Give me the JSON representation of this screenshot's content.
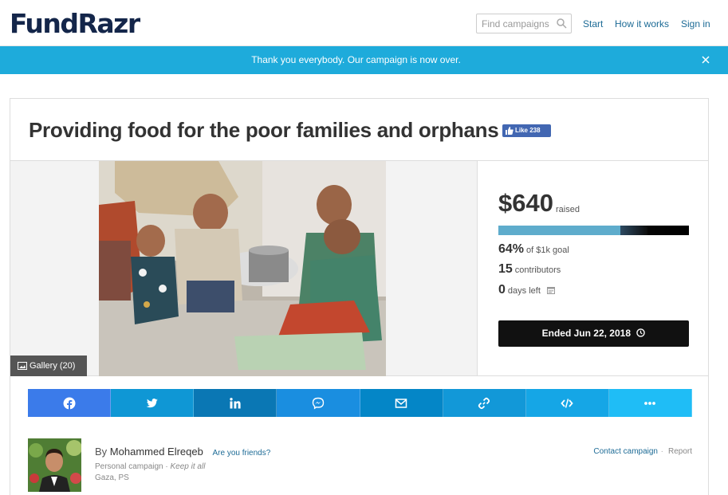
{
  "header": {
    "logo": "FundRazr",
    "search_placeholder": "Find campaigns",
    "nav": [
      "Start",
      "How it works",
      "Sign in"
    ]
  },
  "banner": {
    "message": "Thank you everybody. Our campaign is now over.",
    "color": "#1eabdb"
  },
  "campaign": {
    "title": "Providing food for the poor families and orphans",
    "fb_like": "Like 238",
    "gallery": "Gallery (20)",
    "amount": "$640",
    "amount_label": "raised",
    "progress_percent": 64,
    "goal_percent": "64%",
    "goal_label": "of $1k goal",
    "contributors": "15",
    "contributors_label": "contributors",
    "days_left": "0",
    "days_left_label": "days left",
    "ended_label": "Ended Jun 22, 2018"
  },
  "share": [
    {
      "icon": "facebook-icon",
      "color": "#3b7bea"
    },
    {
      "icon": "twitter-icon",
      "color": "#0f97d5"
    },
    {
      "icon": "linkedin-icon",
      "color": "#0a77b4"
    },
    {
      "icon": "messenger-icon",
      "color": "#1a8ee0"
    },
    {
      "icon": "email-icon",
      "color": "#0486c7"
    },
    {
      "icon": "link-icon",
      "color": "#1298d8"
    },
    {
      "icon": "embed-icon",
      "color": "#15a6e6"
    },
    {
      "icon": "more-icon",
      "color": "#1fbdf6"
    }
  ],
  "author": {
    "by": "By",
    "name": "Mohammed Elreqeb",
    "friends_link": "Are you friends?",
    "campaign_type": "Personal campaign",
    "separator": "·",
    "keep": "Keep it all",
    "location": "Gaza, PS",
    "contact": "Contact campaign",
    "report": "Report"
  }
}
